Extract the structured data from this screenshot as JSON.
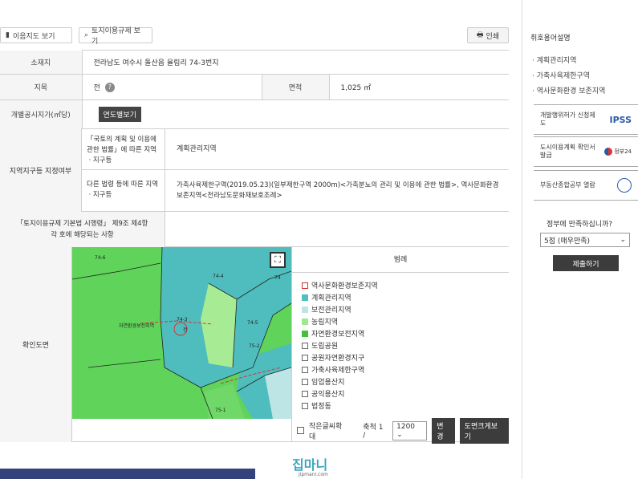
{
  "toolbar": {
    "btn1": "이음지도 보기",
    "btn2": "토지이용규제 보기",
    "print": "인쇄"
  },
  "info": {
    "location_label": "소재지",
    "location_value": "전라남도 여수시 돌산읍 율림리 74-3번지",
    "jimok_label": "지목",
    "jimok_value": "전",
    "area_label": "면적",
    "area_value": "1,025 ㎡",
    "price_label": "개별공시지가(㎡당)",
    "price_button": "연도별보기",
    "zone_label": "지역지구등 지정여부",
    "zone_law1": "「국토의 계획 및 이용에 관한 법률」에 따른 지역ㆍ지구등",
    "zone_val1": "계획관리지역",
    "zone_law2": "다른 법령 등에 따른 지역ㆍ지구등",
    "zone_val2": "가축사육제한구역(2019.05.23)(일부제한구역 2000m)<가축분뇨의 관리 및 이용에 관한 법률>, 역사문화환경보존지역<전라남도문화재보호조례>",
    "decree_label": "「토지이용규제 기본법 시행령」 제9조 제4항 각 호에 해당되는 사항",
    "map_label": "확인도면"
  },
  "legend": {
    "title": "범례",
    "items": [
      {
        "label": "역사문화환경보존지역",
        "color": "#ffffff",
        "border": "#cc3333"
      },
      {
        "label": "계획관리지역",
        "color": "#4fc0c0",
        "border": "#4fc0c0"
      },
      {
        "label": "보전관리지역",
        "color": "#bde5e5",
        "border": "#bde5e5"
      },
      {
        "label": "농림지역",
        "color": "#9ee88e",
        "border": "#9ee88e"
      },
      {
        "label": "자연환경보전지역",
        "color": "#3ec23a",
        "border": "#3ec23a"
      },
      {
        "label": "도립공원",
        "color": "#ffffff",
        "border": "#666666"
      },
      {
        "label": "공원자연환경지구",
        "color": "#ffffff",
        "border": "#666666"
      },
      {
        "label": "가축사육제한구역",
        "color": "#ffffff",
        "border": "#666666"
      },
      {
        "label": "임업용산지",
        "color": "#ffffff",
        "border": "#666666"
      },
      {
        "label": "공익용산지",
        "color": "#ffffff",
        "border": "#666666"
      },
      {
        "label": "법정동",
        "color": "#ffffff",
        "border": "#666666"
      }
    ]
  },
  "map_controls": {
    "checkbox_label": "작은글씨확대",
    "scale_label": "축척 1 /",
    "scale_value": "1200",
    "change_button": "변경",
    "large_button": "도면크게보기"
  },
  "map_labels": {
    "parcel_main": "74-3",
    "parcel_main_jimok": "전",
    "parcel_a": "74-4",
    "parcel_b": "74-5",
    "parcel_c": "74-6",
    "parcel_d": "74",
    "parcel_e": "75-2",
    "parcel_f": "75-1",
    "area_left": "자연환경보전지역"
  },
  "sidebar": {
    "title": "취호용어설명",
    "terms": [
      "계획관리지역",
      "가축사육제한구역",
      "역사문화환경 보존지역"
    ],
    "banner1_text": "개발행위허가 신청제도",
    "banner1_logo": "IPSS",
    "banner2_text": "도시이용계획 확인서 발급",
    "banner2_logo": "정부24",
    "banner3_text": "부동산종합공부 열람",
    "survey_question": "정부에 만족하십니까?",
    "survey_option": "5점 (매우만족)",
    "survey_button": "제출하기"
  },
  "watermark": {
    "brand": "집마니",
    "url": "jipmani.com"
  }
}
